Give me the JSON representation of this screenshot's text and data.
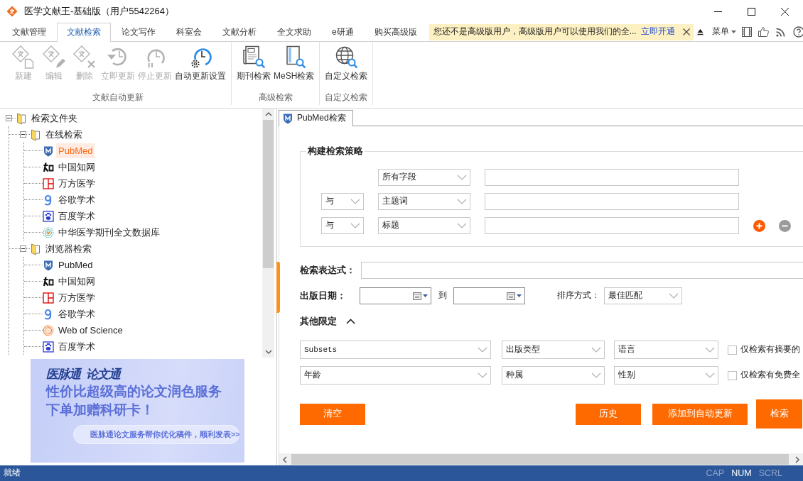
{
  "window": {
    "title": "医学文献王-基础版（用户5542264）"
  },
  "tabs": [
    {
      "label": "文献管理",
      "selected": false
    },
    {
      "label": "文献检索",
      "selected": true
    },
    {
      "label": "论文写作",
      "selected": false
    },
    {
      "label": "科室会",
      "selected": false
    },
    {
      "label": "文献分析",
      "selected": false
    },
    {
      "label": "全文求助",
      "selected": false
    },
    {
      "label": "e研通",
      "selected": false
    },
    {
      "label": "购买高级版",
      "selected": false
    }
  ],
  "notice": {
    "text": "您还不是高级版用户，高级版用户可以使用我们的全...",
    "link": "立即开通"
  },
  "menu": {
    "label": "菜单"
  },
  "ribbon": {
    "groups": [
      {
        "label": "文献自动更新",
        "buttons": [
          {
            "label": "新建",
            "kind": "doc-new",
            "disabled": true
          },
          {
            "label": "编辑",
            "kind": "doc-edit",
            "disabled": true
          },
          {
            "label": "删除",
            "kind": "doc-delete",
            "disabled": true
          },
          {
            "label": "立即更新",
            "kind": "clock-refresh",
            "disabled": true
          },
          {
            "label": "停止更新",
            "kind": "clock-pause",
            "disabled": true
          },
          {
            "label": "自动更新设置",
            "kind": "clock-gear",
            "disabled": false
          }
        ]
      },
      {
        "label": "高级检索",
        "buttons": [
          {
            "label": "期刊检索",
            "kind": "newspaper-search",
            "disabled": false
          },
          {
            "label": "MeSH检索",
            "kind": "book-search",
            "disabled": false
          }
        ]
      },
      {
        "label": "自定义检索",
        "buttons": [
          {
            "label": "自定义检索",
            "kind": "globe-search",
            "disabled": false
          }
        ]
      }
    ]
  },
  "tree": {
    "label": "检索文件夹",
    "expanded": true,
    "children": [
      {
        "label": "在线检索",
        "expanded": true,
        "children": [
          {
            "label": "PubMed",
            "kind": "shield",
            "selected": true
          },
          {
            "label": "中国知网",
            "kind": "brush",
            "selected": false
          },
          {
            "label": "万方医学",
            "kind": "frame",
            "selected": false
          },
          {
            "label": "谷歌学术",
            "kind": "g",
            "selected": false
          },
          {
            "label": "百度学术",
            "kind": "paw",
            "selected": false
          },
          {
            "label": "中华医学期刊全文数据库",
            "kind": "emblem",
            "selected": false
          }
        ]
      },
      {
        "label": "浏览器检索",
        "expanded": true,
        "children": [
          {
            "label": "PubMed",
            "kind": "shield",
            "selected": false
          },
          {
            "label": "中国知网",
            "kind": "brush",
            "selected": false
          },
          {
            "label": "万方医学",
            "kind": "frame",
            "selected": false
          },
          {
            "label": "谷歌学术",
            "kind": "g",
            "selected": false
          },
          {
            "label": "Web of Science",
            "kind": "swirl",
            "selected": false
          },
          {
            "label": "百度学术",
            "kind": "paw",
            "selected": false
          }
        ]
      }
    ]
  },
  "ad": {
    "brand": "医脉通",
    "product": "论文通",
    "headline": [
      "性价比超级高的论文润色服务",
      "下单加赠科研卡！"
    ],
    "cta": "医脉通论文服务帮你优化稿件，顺利发表>>"
  },
  "search_tabs": [
    {
      "label": "PubMed检索",
      "selected": true
    }
  ],
  "strategy": {
    "title": "构建检索策略",
    "rows": [
      {
        "field": "所有字段"
      },
      {
        "operator": "与",
        "field": "主题词"
      },
      {
        "operator": "与",
        "field": "标题"
      }
    ]
  },
  "expression": {
    "label": "检索表达式："
  },
  "date": {
    "label": "出版日期：",
    "separator": "到"
  },
  "sort": {
    "label": "排序方式：",
    "value": "最佳匹配"
  },
  "other_limits": {
    "title": "其他限定",
    "expanded": true,
    "rows": [
      {
        "selects": [
          "Subsets",
          "出版类型",
          "语言"
        ],
        "checkbox": {
          "label": "仅检索有摘要的",
          "checked": false
        }
      },
      {
        "selects": [
          "年龄",
          "种属",
          "性别"
        ],
        "checkbox": {
          "label": "仅检索有免费全",
          "checked": false
        }
      }
    ]
  },
  "actions": [
    {
      "label": "清空",
      "primary": false
    },
    {
      "label": "历史",
      "primary": false
    },
    {
      "label": "添加到自动更新",
      "primary": false
    },
    {
      "label": "检索",
      "primary": true
    }
  ],
  "status_bar": {
    "text": "就绪",
    "indicators": [
      {
        "label": "CAP",
        "on": false
      },
      {
        "label": "NUM",
        "on": true
      },
      {
        "label": "SCRL",
        "on": false
      }
    ]
  }
}
